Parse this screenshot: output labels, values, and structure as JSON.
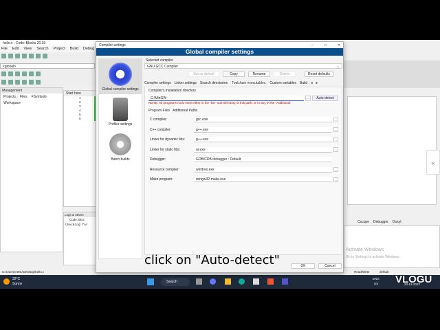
{
  "ide": {
    "title": "hello.c - Code::Blocks 20.03",
    "menu": [
      "File",
      "Edit",
      "View",
      "Search",
      "Project",
      "Build",
      "Debug"
    ],
    "scope": "<global>",
    "management": "Management",
    "mgmt_tabs": [
      "Projects",
      "Files",
      "FSymbols"
    ],
    "workspace": "Workspace",
    "editor_tab": "Start here",
    "line_numbers": [
      "1",
      "2",
      "3",
      "4",
      "5",
      "6"
    ],
    "logs_title": "Logs & others",
    "logs_tab": "Code::Bloc",
    "log_text": "Checking for",
    "right_tabs": [
      "Cscope",
      "Debugger",
      "Doxyl"
    ],
    "status_path": "C:\\Users\\AIML\\Desktop\\hello.c",
    "status_rw": "Read/Write",
    "status_default": "default",
    "watermark_title": "Activate Windows",
    "watermark_sub": "Go to Settings to activate Windows."
  },
  "dialog": {
    "window_title": "Compiler settings",
    "banner": "Global compiler settings",
    "side": [
      {
        "label": "Global compiler settings"
      },
      {
        "label": "Profiler settings"
      },
      {
        "label": "Batch builds"
      }
    ],
    "selected_compiler_label": "Selected compiler",
    "selected_compiler": "GNU GCC Compiler",
    "buttons": {
      "set_default": "Set as default",
      "copy": "Copy",
      "rename": "Rename",
      "delete": "Delete",
      "reset": "Reset defaults"
    },
    "tabs": [
      "Compiler settings",
      "Linker settings",
      "Search directories",
      "Toolchain executables",
      "Custom variables",
      "Build"
    ],
    "install_dir_label": "Compiler's installation directory",
    "install_dir": "C:\\MinGW",
    "browse": "...",
    "auto_detect": "Auto-detect",
    "note": "NOTE: All programs must exist either in the \"bin\" sub-directory of this path, or in any of the \"Additional",
    "subtabs": [
      "Program Files",
      "Additional Paths"
    ],
    "programs": [
      {
        "label": "C compiler:",
        "value": "gcc.exe"
      },
      {
        "label": "C++ compiler:",
        "value": "g++.exe"
      },
      {
        "label": "Linker for dynamic libs:",
        "value": "g++.exe"
      },
      {
        "label": "Linker for static libs:",
        "value": "ar.exe"
      },
      {
        "label": "Debugger:",
        "value": "GDB/CDB debugger : Default"
      },
      {
        "label": "Resource compiler:",
        "value": "windres.exe"
      },
      {
        "label": "Make program:",
        "value": "mingw32-make.exe"
      }
    ],
    "ok": "OK",
    "cancel": "Cancel"
  },
  "taskbar": {
    "temp": "32°C",
    "weather": "Sunny",
    "search": "Search",
    "lang": "ENG",
    "region": "US",
    "date": "23-12-2022"
  },
  "caption": "click on \"Auto-detect\"",
  "logo": "VLOGU",
  "colors": {
    "banner": "#0a4f8c",
    "note": "#c00000"
  }
}
